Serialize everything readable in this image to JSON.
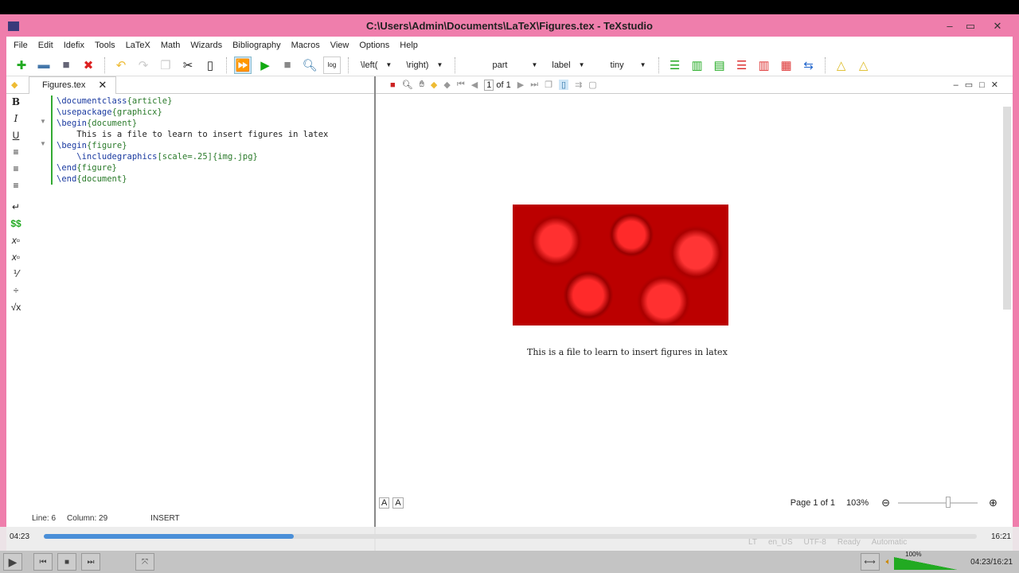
{
  "window": {
    "title": "C:\\Users\\Admin\\Documents\\LaTeX\\Figures.tex - TeXstudio"
  },
  "menu": [
    "File",
    "Edit",
    "Idefix",
    "Tools",
    "LaTeX",
    "Math",
    "Wizards",
    "Bibliography",
    "Macros",
    "View",
    "Options",
    "Help"
  ],
  "toolbar": {
    "left_combo": "\\left(",
    "right_combo": "\\right)",
    "section_combo": "part",
    "label_combo": "label",
    "size_combo": "tiny"
  },
  "tab": {
    "label": "Figures.tex"
  },
  "editor": {
    "lines": [
      {
        "cmd": "\\documentclass",
        "arg": "{article}"
      },
      {
        "cmd": "\\usepackage",
        "arg": "{graphicx}"
      },
      {
        "cmd": "\\begin",
        "arg": "{document}"
      },
      {
        "text": "    This is a file to learn to insert figures in latex"
      },
      {
        "cmd": "\\begin",
        "arg": "{figure}"
      },
      {
        "cmd": "    \\includegraphics",
        "arg": "[scale=.25]{img.jpg}"
      },
      {
        "cmd": "\\end",
        "arg": "{figure}"
      },
      {
        "cmd": "\\end",
        "arg": "{document}"
      }
    ]
  },
  "status": {
    "line": "Line: 6",
    "column": "Column: 29",
    "mode": "INSERT",
    "language": "en_US",
    "encoding": "UTF-8",
    "state": "Ready",
    "auto": "Automatic"
  },
  "viewer": {
    "page_input": "1",
    "page_of": "of 1",
    "caption": "This is a file to learn to insert figures in latex",
    "page_status": "Page 1 of 1",
    "zoom": "103%"
  },
  "player": {
    "elapsed": "04:23",
    "total": "16:21",
    "time_display": "04:23/16:21",
    "volume": "100%",
    "progress": 0.268
  }
}
